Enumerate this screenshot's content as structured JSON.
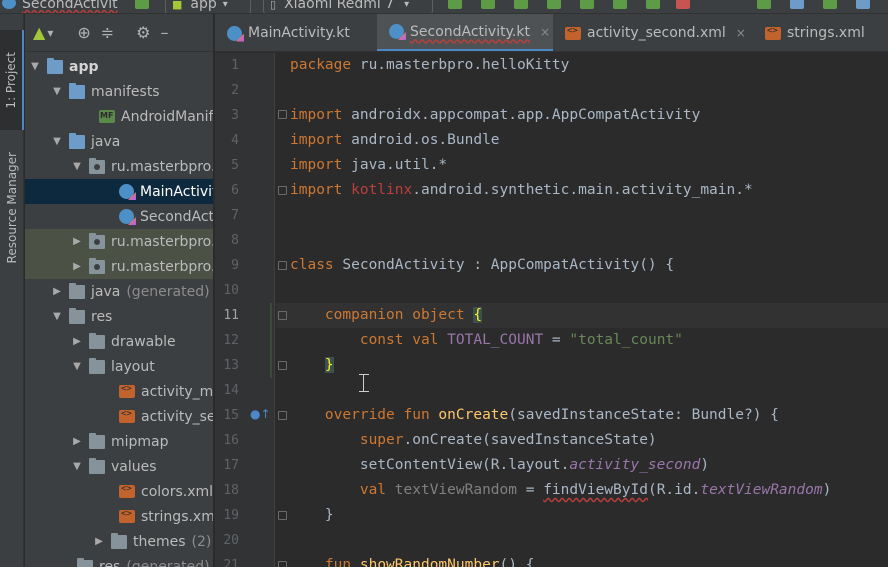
{
  "toolbar": {
    "file_title": "SecondActivit",
    "run_config": "app",
    "device": "Xiaomi Redmi 7"
  },
  "sidebar": {
    "project_tab": "1: Project",
    "resource_tab": "Resource Manager",
    "view_selector": "▾"
  },
  "tree": [
    {
      "label": "app",
      "extra": ""
    },
    {
      "label": "manifests",
      "extra": ""
    },
    {
      "label": "AndroidManifest.xml",
      "extra": ""
    },
    {
      "label": "java",
      "extra": ""
    },
    {
      "label": "ru.masterbpro.helloKitty",
      "extra": ""
    },
    {
      "label": "MainActivity",
      "extra": ""
    },
    {
      "label": "SecondActivity",
      "extra": ""
    },
    {
      "label": "ru.masterbpro.helloKitty",
      "extra": ""
    },
    {
      "label": "ru.masterbpro.helloKitty",
      "extra": ""
    },
    {
      "label": "java",
      "extra": "(generated)"
    },
    {
      "label": "res",
      "extra": ""
    },
    {
      "label": "drawable",
      "extra": ""
    },
    {
      "label": "layout",
      "extra": ""
    },
    {
      "label": "activity_main.xml",
      "extra": ""
    },
    {
      "label": "activity_second.xml",
      "extra": ""
    },
    {
      "label": "mipmap",
      "extra": ""
    },
    {
      "label": "values",
      "extra": ""
    },
    {
      "label": "colors.xml",
      "extra": ""
    },
    {
      "label": "strings.xml",
      "extra": ""
    },
    {
      "label": "themes",
      "extra": "(2)"
    },
    {
      "label": "res",
      "extra": "(generated)"
    }
  ],
  "tabs": [
    {
      "label": "MainActivity.kt",
      "close": "×"
    },
    {
      "label": "SecondActivity.kt",
      "close": "×"
    },
    {
      "label": "activity_second.xml",
      "close": "×"
    },
    {
      "label": "strings.xml",
      "close": "×"
    }
  ],
  "editor": {
    "line_numbers": [
      "1",
      "2",
      "3",
      "4",
      "5",
      "6",
      "7",
      "8",
      "9",
      "10",
      "11",
      "12",
      "13",
      "14",
      "15",
      "16",
      "17",
      "18",
      "19",
      "20",
      "21"
    ],
    "tokens": {
      "package": "package",
      "package_name": " ru.masterbpro.helloKitty",
      "import": "import",
      "imp1": " androidx.appcompat.app.AppCompatActivity",
      "imp2": " android.os.Bundle",
      "imp3": " java.util.*",
      "imp4a": " kotlinx",
      "imp4b": ".android.synthetic.main.activity_main.*",
      "class": "class",
      "class_sig": " SecondActivity : AppCompatActivity() {",
      "companion": "companion object",
      "brace_open": "{",
      "const": "const val",
      "const_name": "TOTAL_COUNT",
      "eq": " = ",
      "const_value": "\"total_count\"",
      "brace_close": "}",
      "override": "override fun",
      "fn_oncreate": "onCreate",
      "oncreate_params": "(savedInstanceState: Bundle?) {",
      "super": "super",
      "super_call": ".onCreate(savedInstanceState)",
      "setcontent": "setContentView(R.layout.",
      "layout_ref": "activity_second",
      "close_paren": ")",
      "val": "val",
      "val_name": " textViewRandom",
      "find": "findViewById",
      "find_args": "(R.id.",
      "id_ref": "textViewRandom",
      "end_brace": "}",
      "fun": "fun",
      "fn_show": "showRandomNumber",
      "show_rest": "() {"
    }
  },
  "colors": {
    "accent": "#4a88c7",
    "keyword": "#cc7832",
    "function": "#ffc66d",
    "constant": "#9876aa",
    "string": "#6a8759"
  }
}
